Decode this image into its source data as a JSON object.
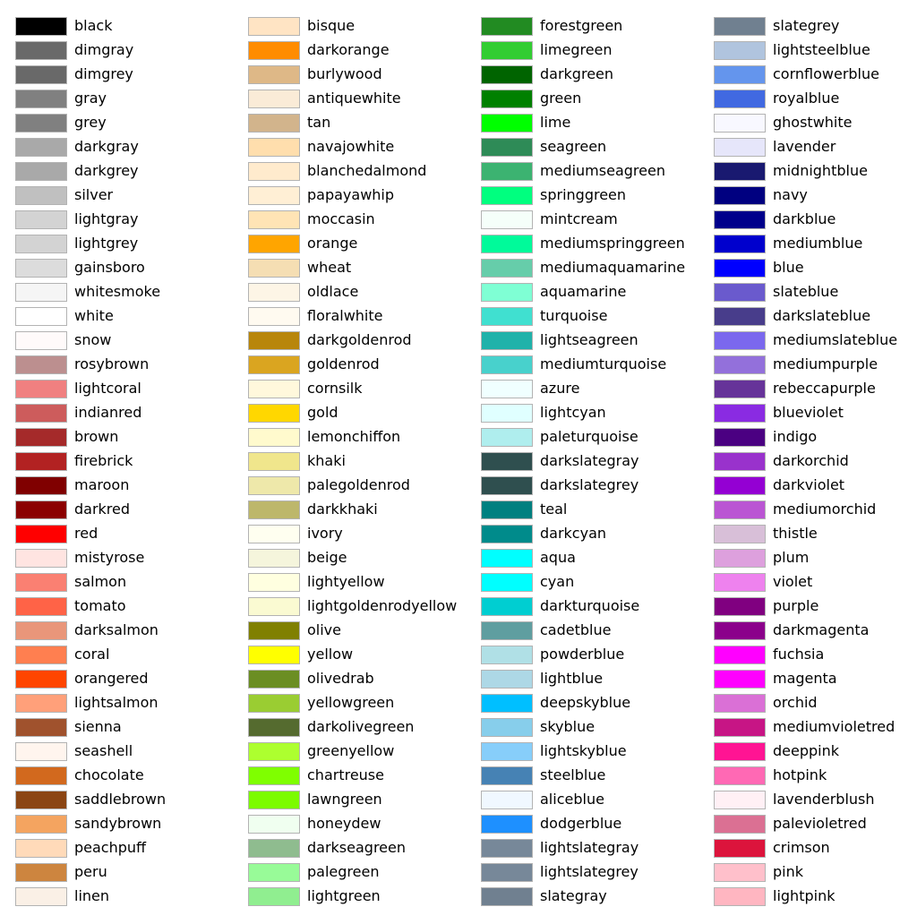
{
  "chart_data": {
    "type": "table",
    "columns": [
      [
        "black",
        "dimgray",
        "dimgrey",
        "gray",
        "grey",
        "darkgray",
        "darkgrey",
        "silver",
        "lightgray",
        "lightgrey",
        "gainsboro",
        "whitesmoke",
        "white",
        "snow",
        "rosybrown",
        "lightcoral",
        "indianred",
        "brown",
        "firebrick",
        "maroon",
        "darkred",
        "red",
        "mistyrose",
        "salmon",
        "tomato",
        "darksalmon",
        "coral",
        "orangered",
        "lightsalmon",
        "sienna",
        "seashell",
        "chocolate",
        "saddlebrown",
        "sandybrown",
        "peachpuff",
        "peru",
        "linen"
      ],
      [
        "bisque",
        "darkorange",
        "burlywood",
        "antiquewhite",
        "tan",
        "navajowhite",
        "blanchedalmond",
        "papayawhip",
        "moccasin",
        "orange",
        "wheat",
        "oldlace",
        "floralwhite",
        "darkgoldenrod",
        "goldenrod",
        "cornsilk",
        "gold",
        "lemonchiffon",
        "khaki",
        "palegoldenrod",
        "darkkhaki",
        "ivory",
        "beige",
        "lightyellow",
        "lightgoldenrodyellow",
        "olive",
        "yellow",
        "olivedrab",
        "yellowgreen",
        "darkolivegreen",
        "greenyellow",
        "chartreuse",
        "lawngreen",
        "honeydew",
        "darkseagreen",
        "palegreen",
        "lightgreen"
      ],
      [
        "forestgreen",
        "limegreen",
        "darkgreen",
        "green",
        "lime",
        "seagreen",
        "mediumseagreen",
        "springgreen",
        "mintcream",
        "mediumspringgreen",
        "mediumaquamarine",
        "aquamarine",
        "turquoise",
        "lightseagreen",
        "mediumturquoise",
        "azure",
        "lightcyan",
        "paleturquoise",
        "darkslategray",
        "darkslategrey",
        "teal",
        "darkcyan",
        "aqua",
        "cyan",
        "darkturquoise",
        "cadetblue",
        "powderblue",
        "lightblue",
        "deepskyblue",
        "skyblue",
        "lightskyblue",
        "steelblue",
        "aliceblue",
        "dodgerblue",
        "lightslategray",
        "lightslategrey",
        "slategray"
      ],
      [
        "slategrey",
        "lightsteelblue",
        "cornflowerblue",
        "royalblue",
        "ghostwhite",
        "lavender",
        "midnightblue",
        "navy",
        "darkblue",
        "mediumblue",
        "blue",
        "slateblue",
        "darkslateblue",
        "mediumslateblue",
        "mediumpurple",
        "rebeccapurple",
        "blueviolet",
        "indigo",
        "darkorchid",
        "darkviolet",
        "mediumorchid",
        "thistle",
        "plum",
        "violet",
        "purple",
        "darkmagenta",
        "fuchsia",
        "magenta",
        "orchid",
        "mediumvioletred",
        "deeppink",
        "hotpink",
        "lavenderblush",
        "palevioletred",
        "crimson",
        "pink",
        "lightpink"
      ]
    ]
  }
}
